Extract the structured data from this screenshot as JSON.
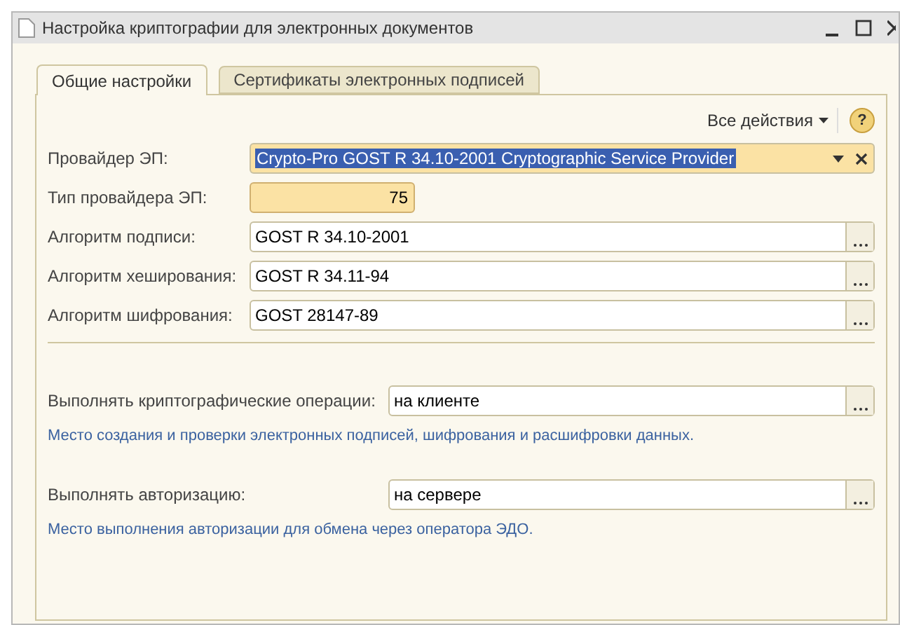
{
  "window": {
    "title": "Настройка криптографии для электронных документов"
  },
  "tabs": [
    {
      "label": "Общие настройки",
      "selected": true
    },
    {
      "label": "Сертификаты электронных подписей",
      "selected": false
    }
  ],
  "toolbar": {
    "actions_menu": "Все действия",
    "help": "?"
  },
  "fields": [
    {
      "kind": "combo",
      "label": "Провайдер ЭП:",
      "value": "Crypto-Pro GOST R 34.10-2001 Cryptographic Service Provider",
      "text_selected": true
    },
    {
      "kind": "number",
      "label": "Тип провайдера ЭП:",
      "value": "75",
      "text_selected": false
    },
    {
      "kind": "choice",
      "label": "Алгоритм подписи:",
      "value": "GOST R 34.10-2001",
      "text_selected": false
    },
    {
      "kind": "choice",
      "label": "Алгоритм хеширования:",
      "value": "GOST R 34.11-94",
      "text_selected": false
    },
    {
      "kind": "choice",
      "label": "Алгоритм шифрования:",
      "value": "GOST 28147-89",
      "text_selected": false
    }
  ],
  "options": [
    {
      "label": "Выполнять криптографические операции:",
      "value": "на клиенте",
      "note": "Место создания и проверки электронных подписей, шифрования и расшифровки данных."
    },
    {
      "label": "Выполнять авторизацию:",
      "value": "на сервере",
      "note": "Место выполнения авторизации для обмена через оператора ЭДО."
    }
  ]
}
